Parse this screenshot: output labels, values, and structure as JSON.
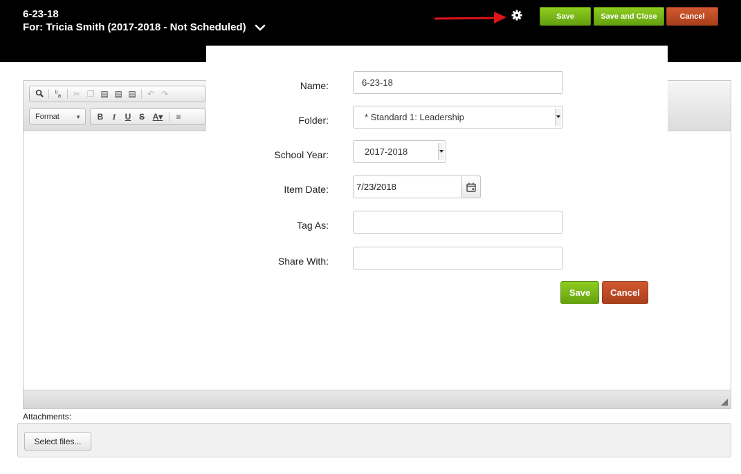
{
  "header": {
    "title": "6-23-18",
    "subtitle": "For: Tricia Smith (2017-2018 - Not Scheduled)",
    "save_label": "Save",
    "save_close_label": "Save and Close",
    "cancel_label": "Cancel"
  },
  "editor": {
    "format_label": "Format"
  },
  "attachments": {
    "label": "Attachments:",
    "select_files_label": "Select files..."
  },
  "modal": {
    "name": {
      "label": "Name:",
      "value": "6-23-18"
    },
    "folder": {
      "label": "Folder:",
      "value": "* Standard 1: Leadership"
    },
    "school_year": {
      "label": "School Year:",
      "value": "2017-2018"
    },
    "item_date": {
      "label": "Item Date:",
      "value": "7/23/2018"
    },
    "tag_as": {
      "label": "Tag As:",
      "value": ""
    },
    "share_with": {
      "label": "Share With:",
      "value": ""
    },
    "save_label": "Save",
    "cancel_label": "Cancel"
  },
  "colors": {
    "header_bg": "#000000",
    "button_green": "#75b317",
    "button_red": "#bd4b22",
    "arrow_red": "#e0141b"
  }
}
